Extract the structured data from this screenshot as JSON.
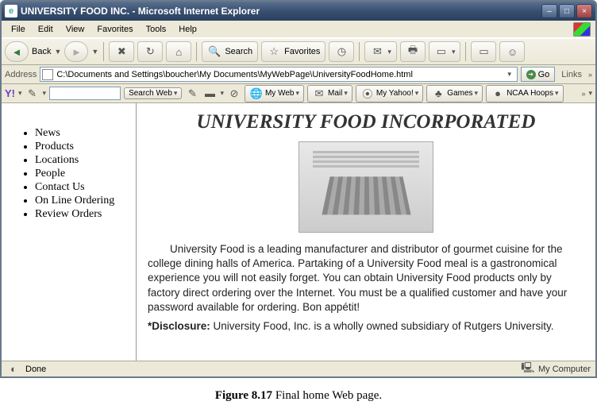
{
  "window": {
    "title": "UNIVERSITY FOOD INC. - Microsoft Internet Explorer"
  },
  "menu": {
    "items": [
      "File",
      "Edit",
      "View",
      "Favorites",
      "Tools",
      "Help"
    ]
  },
  "toolbar": {
    "back": "Back",
    "search": "Search",
    "favorites": "Favorites"
  },
  "addressbar": {
    "label": "Address",
    "value": "C:\\Documents and Settings\\boucher\\My Documents\\MyWebPage\\UniversityFoodHome.html",
    "go": "Go",
    "links": "Links"
  },
  "yahoobar": {
    "logo": "Y!",
    "searchweb": "Search Web",
    "myweb": "My Web",
    "mail": "Mail",
    "myyahoo": "My Yahoo!",
    "games": "Games",
    "ncaa": "NCAA Hoops"
  },
  "sidebar": {
    "items": [
      {
        "label": "News"
      },
      {
        "label": "Products"
      },
      {
        "label": "Locations"
      },
      {
        "label": "People"
      },
      {
        "label": "Contact Us"
      },
      {
        "label": "On Line Ordering"
      },
      {
        "label": "Review Orders"
      }
    ]
  },
  "main": {
    "heading": "UNIVERSITY FOOD INCORPORATED",
    "intro": "University Food is a leading manufacturer and distributor of gourmet cuisine for the college dining halls of America. Partaking of a University Food meal is a gastronomical experience you will not easily forget. You can obtain University Food products only by factory direct ordering over the Internet. You must be a qualified customer and have your password available for ordering. Bon appétit!",
    "disclosure_label": "*Disclosure:",
    "disclosure_text": " University Food, Inc. is a wholly owned subsidiary of Rutgers University."
  },
  "statusbar": {
    "status": "Done",
    "zone": "My Computer"
  },
  "caption": {
    "figure": "Figure 8.17",
    "text": "   Final home Web page."
  }
}
